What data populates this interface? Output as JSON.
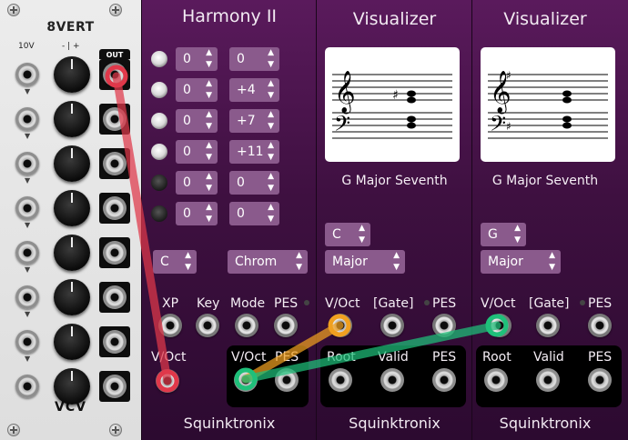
{
  "eightvert": {
    "title": "8VERT",
    "label_10v": "10V",
    "label_minus_plus": "- | +",
    "out_label": "OUT",
    "brand": "VCV",
    "rows": 8
  },
  "harmony": {
    "title": "Harmony II",
    "rows": [
      {
        "led": "on",
        "left": "0",
        "right": "0"
      },
      {
        "led": "on",
        "left": "0",
        "right": "+4"
      },
      {
        "led": "on",
        "left": "0",
        "right": "+7"
      },
      {
        "led": "on",
        "left": "0",
        "right": "+11"
      },
      {
        "led": "off",
        "left": "0",
        "right": "0"
      },
      {
        "led": "off",
        "left": "0",
        "right": "0"
      }
    ],
    "key_value": "C",
    "mode_value": "Chrom",
    "jack_labels": [
      "XP",
      "Key",
      "Mode",
      "PES"
    ],
    "voct_label": "V/Oct",
    "out_labels": [
      "V/Oct",
      "PES"
    ],
    "brand": "Squinktronix"
  },
  "visualizer1": {
    "title": "Visualizer",
    "chord_name": "G Major Seventh",
    "key_value": "C",
    "mode_value": "Major",
    "in_labels": [
      "V/Oct",
      "[Gate]",
      "PES"
    ],
    "out_labels": [
      "Root",
      "Valid",
      "PES"
    ],
    "brand": "Squinktronix"
  },
  "visualizer2": {
    "title": "Visualizer",
    "chord_name": "G Major Seventh",
    "key_value": "G",
    "mode_value": "Major",
    "in_labels": [
      "V/Oct",
      "[Gate]",
      "PES"
    ],
    "out_labels": [
      "Root",
      "Valid",
      "PES"
    ],
    "brand": "Squinktronix"
  },
  "colors": {
    "cable_red": "#e0384a",
    "cable_orange": "#f0a020",
    "cable_green": "#1fc07a",
    "panel_purple": "#4a144c",
    "spinner": "#8a5a8c"
  }
}
